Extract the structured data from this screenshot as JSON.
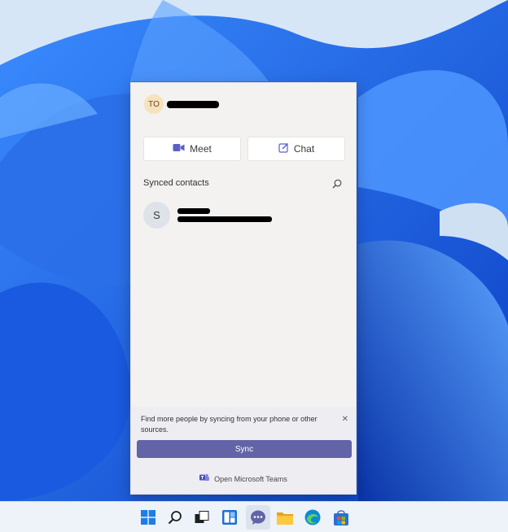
{
  "flyout": {
    "profile_initials": "TO",
    "meet_label": "Meet",
    "chat_label": "Chat",
    "section_title": "Synced contacts",
    "contact_initial": "S",
    "sync_message": "Find more people by syncing from your phone or other sources.",
    "sync_button_label": "Sync",
    "open_teams_label": "Open Microsoft Teams"
  },
  "taskbar": {
    "icons": [
      "windows-start-icon",
      "search-icon",
      "task-view-icon",
      "widgets-icon",
      "chat-icon",
      "file-explorer-icon",
      "edge-icon",
      "store-icon"
    ]
  },
  "colors": {
    "teams_purple": "#6264a7",
    "flyout_bg": "#f3f2f1",
    "wallpaper_blue": "#1457d8"
  }
}
